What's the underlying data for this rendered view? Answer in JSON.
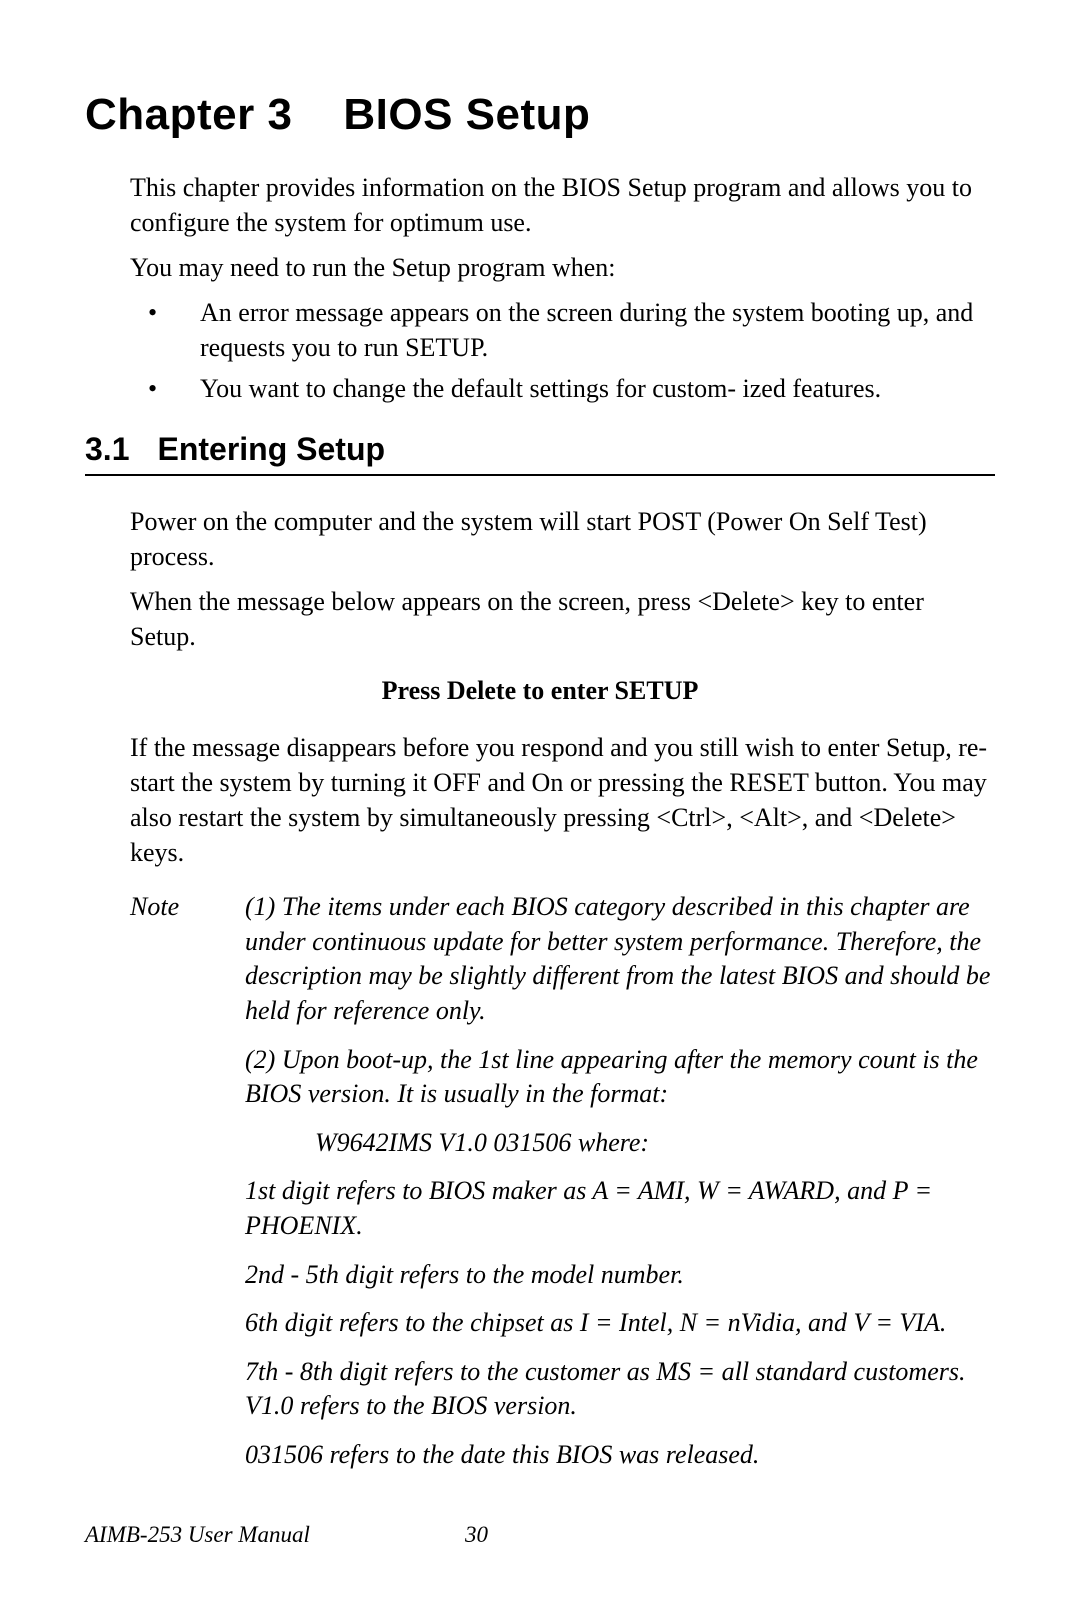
{
  "chapter": {
    "number": "Chapter 3",
    "title": "BIOS Setup"
  },
  "intro": {
    "p1": "This chapter provides information on  the  BIOS  Setup  program and allows you to configure  the system for optimum use.",
    "p2": "You may need to run the Setup program when:",
    "bullets": [
      "An error message appears on the screen during the system booting up, and requests you to run SETUP.",
      "You want to change the default settings for custom- ized features."
    ]
  },
  "section": {
    "number": "3.1",
    "title": "Entering Setup",
    "p1": "Power on the computer and the system will start POST (Power On Self Test) process.",
    "p2": "When the message below appears on the screen, press <Delete> key to enter Setup.",
    "prompt": "Press Delete to enter SETUP",
    "p3": "If the message disappears before you respond and you still wish to enter Setup, re- start the system by turning it OFF and On or pressing the RESET button. You may also restart the system by simultaneously press­ing <Ctrl>, <Alt>, and <Delete> keys."
  },
  "note": {
    "label": "Note",
    "p1": "(1) The items under each BIOS category described in  this chapter  are  under continuous update for better system perfor­mance. Therefore, the description may be slightly different from the latest BIOS and should be held for reference only.",
    "p2": "(2) Upon boot-up, the 1st line appearing after the memory count  is  the  BIOS version. It is usually in the format:",
    "version_line": "W9642IMS V1.0 031506 where:",
    "p3": "1st digit refers to BIOS maker as A = AMI, W = AWARD, and P = PHOENIX.",
    "p4": "2nd - 5th digit refers to the model number.",
    "p5": "6th digit refers to the chipset as I = Intel, N = nVidia, and V = VIA.",
    "p6": "7th - 8th digit refers to the customer as MS = all standard cus­tomers. V1.0 refers to the BIOS version.",
    "p7": "031506 refers to the date this BIOS was released."
  },
  "footer": {
    "doc_title": "AIMB-253 User Manual",
    "page_number": "30"
  }
}
